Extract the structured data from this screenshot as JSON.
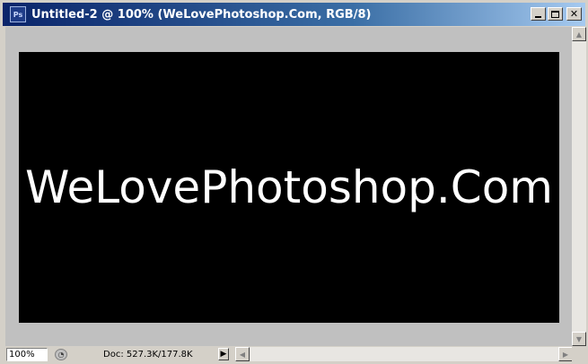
{
  "window": {
    "title": "Untitled-2 @ 100% (WeLovePhotoshop.Com, RGB/8)",
    "app_icon_text": "Ps",
    "minimize_label": "_",
    "maximize_label": "□",
    "close_label": "✕"
  },
  "document": {
    "text": "WeLovePhotoshop.Com",
    "background_color": "#000000",
    "text_color": "#ffffff"
  },
  "statusbar": {
    "zoom": "100%",
    "doc_info": "Doc: 527.3K/177.8K",
    "menu_arrow": "▶"
  },
  "scrollbar": {
    "up_arrow": "▲",
    "down_arrow": "▼",
    "left_arrow": "◀",
    "right_arrow": "▶"
  },
  "icons": {
    "app": "photoshop-icon",
    "status": "status-indicator-icon"
  }
}
